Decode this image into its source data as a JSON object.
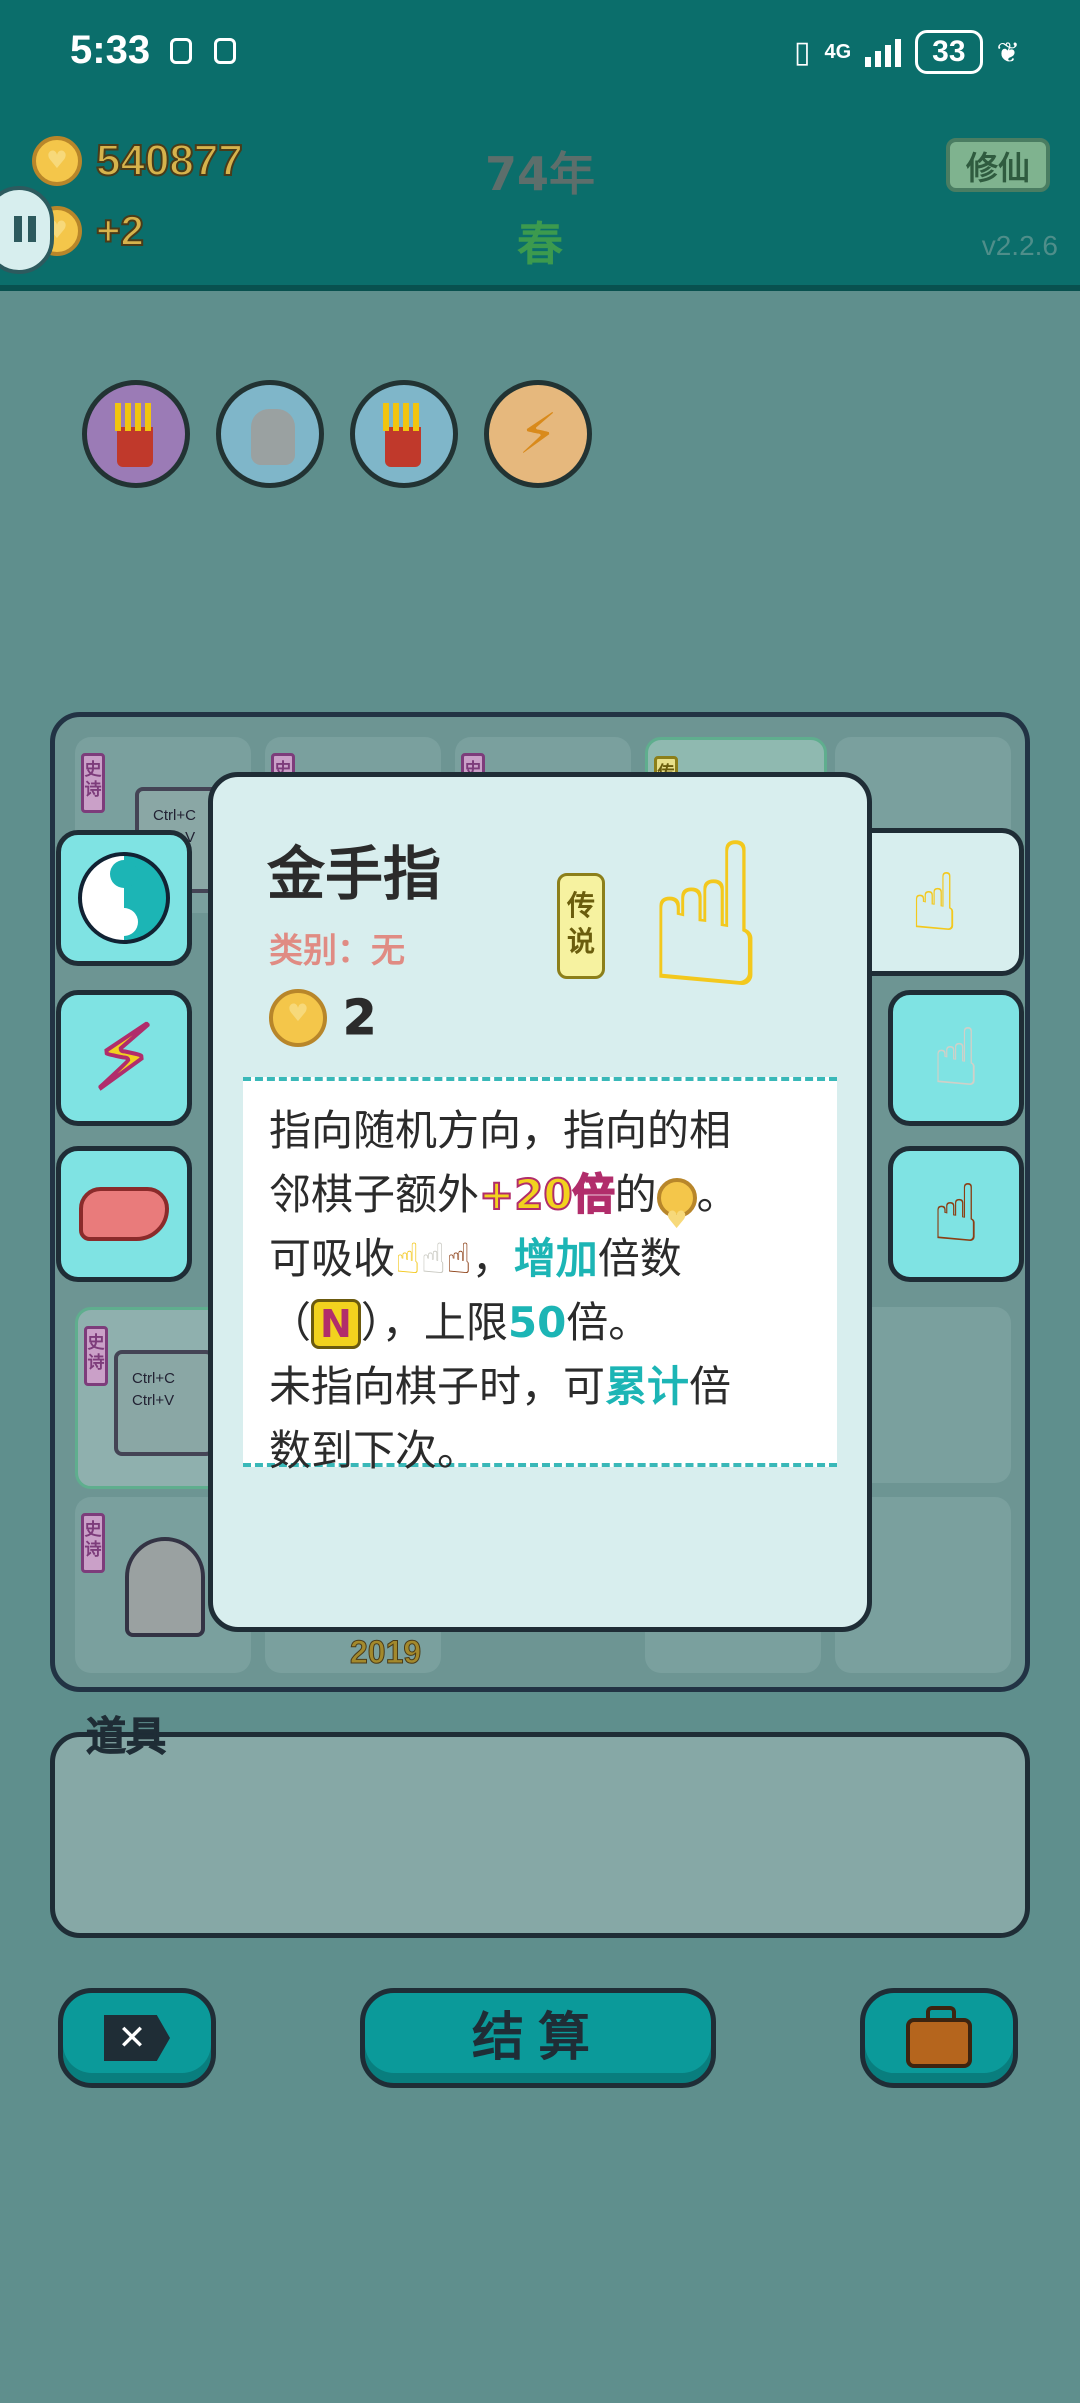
{
  "status_bar": {
    "time": "5:33",
    "network": "4G",
    "battery": "33"
  },
  "header": {
    "money": "540877",
    "income": "+2",
    "year": "74年",
    "season": "春",
    "mode_button": "修仙",
    "version": "v2.2.6"
  },
  "owned_items": [
    {
      "icon": "fries-icon"
    },
    {
      "icon": "husky-icon"
    },
    {
      "icon": "fries-icon"
    },
    {
      "icon": "lightning-icon"
    }
  ],
  "board": {
    "tag_text": "史诗",
    "tag_text_legend": "传",
    "ctrl_line1": "Ctrl+C",
    "ctrl_line2": "Ctrl+V",
    "year_label": "2019"
  },
  "detail": {
    "name": "金手指",
    "category": "类别：无",
    "rarity": "传说",
    "cost": "2",
    "desc": {
      "line1": "指向随机方向，指向的相",
      "line2a": "邻棋子额外",
      "line2b": "+20倍",
      "line2c": "的",
      "line2d": "。",
      "line3a": "可吸收",
      "line3b": "，",
      "line3c": "增加",
      "line3d": "倍数",
      "line4a": "（",
      "line4b": "N",
      "line4c": "），上限",
      "line4d": "50",
      "line4e": "倍。",
      "line5a": "未指向棋子时，可",
      "line5b": "累计",
      "line5c": "倍",
      "line6": "数到下次。"
    }
  },
  "props": {
    "label": "道具"
  },
  "actions": {
    "settle": "结算"
  },
  "colors": {
    "teal": "#0b6e6b",
    "panel": "#d8eeee",
    "accent_teal": "#1cb5b5",
    "gold": "#f3c81d"
  }
}
